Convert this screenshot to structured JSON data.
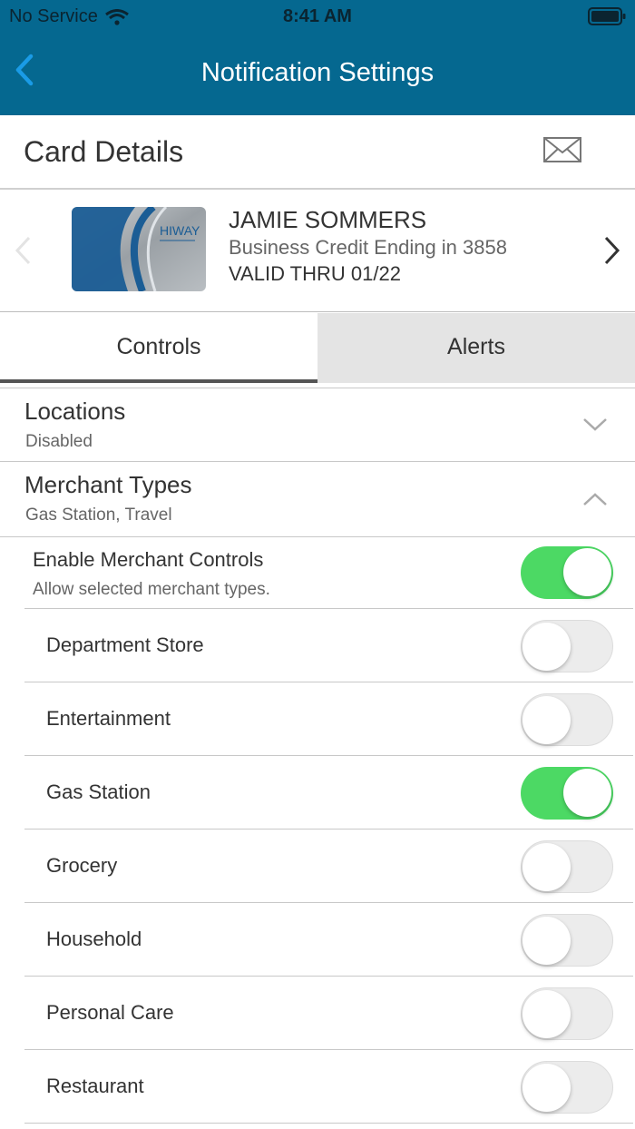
{
  "status_bar": {
    "carrier": "No Service",
    "time": "8:41 AM"
  },
  "nav": {
    "title": "Notification Settings",
    "back_icon": "chevron-left-icon"
  },
  "card_details": {
    "heading": "Card Details",
    "mail_icon": "envelope-icon"
  },
  "card": {
    "holder": "JAMIE SOMMERS",
    "description": "Business Credit Ending in 3858",
    "valid_thru": "VALID THRU 01/22",
    "brand_logo_text": "HIWAY"
  },
  "tabs": [
    {
      "label": "Controls",
      "active": true
    },
    {
      "label": "Alerts",
      "active": false
    }
  ],
  "sections": {
    "locations": {
      "title": "Locations",
      "subtitle": "Disabled",
      "expanded": false
    },
    "merchant_types": {
      "title": "Merchant Types",
      "subtitle": "Gas Station, Travel",
      "expanded": true
    }
  },
  "enable_merchant": {
    "title": "Enable Merchant Controls",
    "subtitle": "Allow selected merchant types.",
    "on": true
  },
  "merchants": [
    {
      "label": "Department Store",
      "on": false
    },
    {
      "label": "Entertainment",
      "on": false
    },
    {
      "label": "Gas Station",
      "on": true
    },
    {
      "label": "Grocery",
      "on": false
    },
    {
      "label": "Household",
      "on": false
    },
    {
      "label": "Personal Care",
      "on": false
    },
    {
      "label": "Restaurant",
      "on": false
    }
  ],
  "colors": {
    "header": "#056890",
    "toggle_on": "#4cd964",
    "back_arrow": "#1a9be6"
  }
}
